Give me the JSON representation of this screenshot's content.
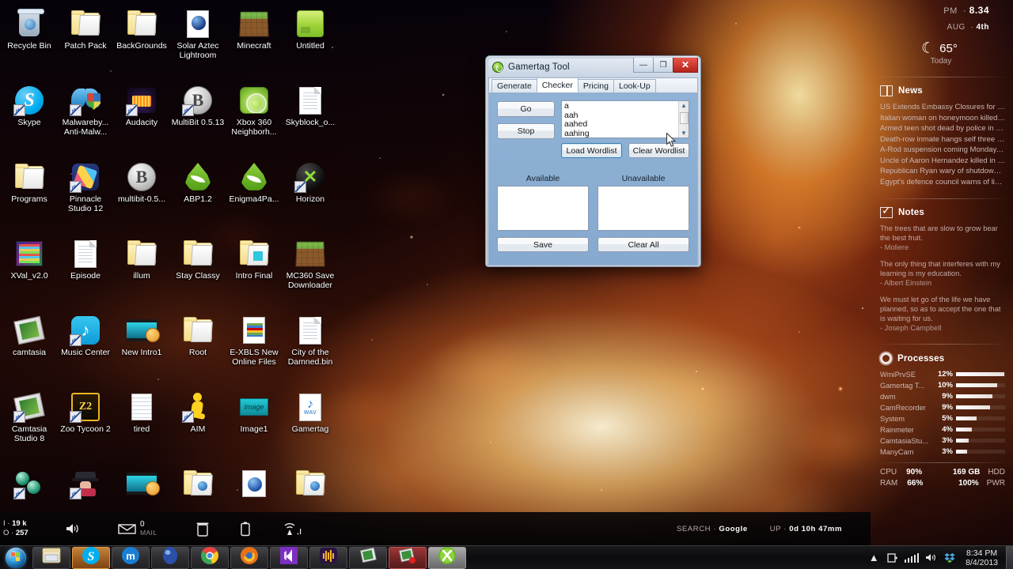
{
  "desktop": {
    "icons": [
      {
        "label": "Recycle Bin",
        "icon": "recycle-bin-icon",
        "type": "trash",
        "shortcut": false
      },
      {
        "label": "Patch Pack",
        "icon": "folder-icon",
        "type": "folder",
        "shortcut": false
      },
      {
        "label": "BackGrounds",
        "icon": "folder-icon",
        "type": "folder",
        "shortcut": false
      },
      {
        "label": "Solar Aztec Lightroom",
        "icon": "document-icon",
        "type": "solar",
        "shortcut": false
      },
      {
        "label": "Minecraft",
        "icon": "minecraft-icon",
        "type": "minecraft",
        "shortcut": false
      },
      {
        "label": "Untitled",
        "icon": "image-icon",
        "type": "untitled",
        "shortcut": false
      },
      {
        "label": "Skype",
        "icon": "skype-icon",
        "type": "skype",
        "shortcut": true
      },
      {
        "label": "Malwareby... Anti-Malw...",
        "icon": "malwarebytes-icon",
        "type": "malware",
        "shortcut": true
      },
      {
        "label": "Audacity",
        "icon": "audacity-icon",
        "type": "audacity",
        "shortcut": true
      },
      {
        "label": "MultiBit 0.5.13",
        "icon": "bitcoin-icon",
        "type": "bitcoin",
        "shortcut": true
      },
      {
        "label": "Xbox 360 Neighborh...",
        "icon": "xbox-neighborhood-icon",
        "type": "xboxgreen",
        "shortcut": false
      },
      {
        "label": "Skyblock_o...",
        "icon": "document-icon",
        "type": "doc",
        "shortcut": false
      },
      {
        "label": "Programs",
        "icon": "folder-icon",
        "type": "folder",
        "shortcut": false
      },
      {
        "label": "Pinnacle Studio 12",
        "icon": "pinnacle-icon",
        "type": "pinnacle",
        "shortcut": true
      },
      {
        "label": "multibit-0.5...",
        "icon": "bitcoin-icon",
        "type": "bitcoin",
        "shortcut": false
      },
      {
        "label": "ABP1.2",
        "icon": "enigma-drop-icon",
        "type": "drop",
        "shortcut": false
      },
      {
        "label": "Enigma4Pa...",
        "icon": "enigma-drop-icon",
        "type": "drop",
        "shortcut": false
      },
      {
        "label": "Horizon",
        "icon": "xbox-icon",
        "type": "xbox",
        "shortcut": true
      },
      {
        "label": "XVal_v2.0",
        "icon": "winrar-archive-icon",
        "type": "winrar",
        "shortcut": false
      },
      {
        "label": "Episode",
        "icon": "document-icon",
        "type": "doc",
        "shortcut": false
      },
      {
        "label": "illum",
        "icon": "folder-icon",
        "type": "folder",
        "shortcut": false
      },
      {
        "label": "Stay Classy",
        "icon": "folder-icon",
        "type": "folder",
        "shortcut": false
      },
      {
        "label": "Intro Final",
        "icon": "folder-icon",
        "type": "folder-video",
        "shortcut": false
      },
      {
        "label": "MC360 Save Downloader",
        "icon": "minecraft-icon",
        "type": "minecraft",
        "shortcut": false
      },
      {
        "label": "camtasia",
        "icon": "camtasia-icon",
        "type": "camtasia",
        "shortcut": false
      },
      {
        "label": "Music Center",
        "icon": "music-icon",
        "type": "music",
        "shortcut": true
      },
      {
        "label": "New Intro1",
        "icon": "video-file-icon",
        "type": "video",
        "shortcut": false
      },
      {
        "label": "Root",
        "icon": "folder-icon",
        "type": "folder-doc",
        "shortcut": false
      },
      {
        "label": "E-XBLS New Online Files",
        "icon": "archive-icon",
        "type": "exbls",
        "shortcut": false
      },
      {
        "label": "City of the Damned.bin",
        "icon": "document-icon",
        "type": "doc",
        "shortcut": false
      },
      {
        "label": "Camtasia Studio 8",
        "icon": "camtasia-icon",
        "type": "camtasia",
        "shortcut": true
      },
      {
        "label": "Zoo Tycoon 2",
        "icon": "zoo-tycoon-icon",
        "type": "zoo",
        "shortcut": true
      },
      {
        "label": "tired",
        "icon": "notepad-icon",
        "type": "notepad",
        "shortcut": false
      },
      {
        "label": "AIM",
        "icon": "aim-icon",
        "type": "aim",
        "shortcut": true
      },
      {
        "label": "Image1",
        "icon": "image-icon",
        "type": "teal",
        "shortcut": false
      },
      {
        "label": "Gamertag",
        "icon": "wav-file-icon",
        "type": "wav",
        "shortcut": false
      },
      {
        "label": "",
        "icon": "atom-icon",
        "type": "atom",
        "shortcut": true
      },
      {
        "label": "",
        "icon": "spy-icon",
        "type": "spy",
        "shortcut": true
      },
      {
        "label": "",
        "icon": "video-file-icon",
        "type": "video",
        "shortcut": false
      },
      {
        "label": "",
        "icon": "folder-icon",
        "type": "folder-globe",
        "shortcut": false
      },
      {
        "label": "",
        "icon": "globe-document-icon",
        "type": "globe",
        "shortcut": false
      },
      {
        "label": "",
        "icon": "folder-icon",
        "type": "folder-globe",
        "shortcut": false
      }
    ]
  },
  "sidebar": {
    "clock": {
      "meridiem": "PM",
      "time": "8.34",
      "month": "AUG",
      "day": "4th"
    },
    "weather": {
      "icon": "moon-icon",
      "temp": "65°",
      "label": "Today"
    },
    "news": {
      "title": "News",
      "icon": "book-icon",
      "items": [
        "US Extends Embassy Closures for a We...",
        "Italian woman on honeymoon killed in...",
        "Armed teen shot dead by police in Ne...",
        "Death-row inmate hangs self three da...",
        "A-Rod suspension coming Monday, but...",
        "Uncle of Aaron Hernandez killed in m...",
        "Republican Ryan wary of shutdown str...",
        "Egypt's defence council warns of limit..."
      ]
    },
    "notes": {
      "title": "Notes",
      "icon": "checklist-icon",
      "items": [
        {
          "text": "The trees that are slow to grow bear the best fruit.",
          "author": "- Moliere"
        },
        {
          "text": "The only thing that interferes with my learning is my education.",
          "author": "- Albert Einstein"
        },
        {
          "text": "We must let go of the life we have planned, so as to accept the one that is waiting for us.",
          "author": "- Joseph Campbell"
        }
      ]
    },
    "processes": {
      "title": "Processes",
      "icon": "gear-icon",
      "items": [
        {
          "name": "WmiPrvSE",
          "pct": "12%",
          "bar": 98
        },
        {
          "name": "Gamertag T...",
          "pct": "10%",
          "bar": 84
        },
        {
          "name": "dwm",
          "pct": "9%",
          "bar": 74
        },
        {
          "name": "CamRecorder",
          "pct": "9%",
          "bar": 70
        },
        {
          "name": "System",
          "pct": "5%",
          "bar": 42
        },
        {
          "name": "Rainmeter",
          "pct": "4%",
          "bar": 33
        },
        {
          "name": "CamtasiaStu...",
          "pct": "3%",
          "bar": 25
        },
        {
          "name": "ManyCam",
          "pct": "3%",
          "bar": 23
        }
      ],
      "system": {
        "cpu_label": "CPU",
        "cpu_value": "90%",
        "ram_label": "RAM",
        "ram_value": "66%",
        "hdd_label": "HDD",
        "hdd_value": "169 GB",
        "pwr_label": "PWR",
        "pwr_value": "100%"
      }
    }
  },
  "dock": {
    "net_in_label": "I",
    "net_in_value": "19 k",
    "net_out_label": "O",
    "net_out_value": "257",
    "volume_icon": "speaker-icon",
    "mail_icon": "envelope-icon",
    "mail_count": "0",
    "mail_label": "MAIL",
    "trash_icon": "trash-icon",
    "battery_icon": "battery-icon",
    "wifi_icon": "wifi-icon",
    "search_label": "SEARCH",
    "search_engine": "Google",
    "uptime_label": "UP",
    "uptime_value": "0d 10h 47mm"
  },
  "taskbar": {
    "start_label": "start-orb",
    "buttons": [
      {
        "name": "explorer",
        "icon": "folder-window-icon",
        "state": "normal"
      },
      {
        "name": "skype",
        "icon": "skype-icon",
        "state": "active"
      },
      {
        "name": "maxthon",
        "icon": "maxthon-icon",
        "state": "normal"
      },
      {
        "name": "blue-ball-app",
        "icon": "blue-sphere-icon",
        "state": "normal"
      },
      {
        "name": "chrome",
        "icon": "chrome-icon",
        "state": "normal"
      },
      {
        "name": "firefox",
        "icon": "firefox-icon",
        "state": "normal"
      },
      {
        "name": "visual-studio",
        "icon": "visual-studio-icon",
        "state": "normal"
      },
      {
        "name": "audacity",
        "icon": "audacity-icon",
        "state": "normal"
      },
      {
        "name": "camtasia",
        "icon": "camtasia-icon",
        "state": "normal"
      },
      {
        "name": "camtasia-rec",
        "icon": "camtasia-record-icon",
        "state": "red"
      },
      {
        "name": "gamertag-tool",
        "icon": "xbox-icon",
        "state": "green"
      }
    ],
    "tray": {
      "chevron_icon": "show-hidden-icons-icon",
      "action_center_icon": "action-center-icon",
      "network_icon": "network-signal-icon",
      "volume_icon": "speaker-icon",
      "dropbox_icon": "dropbox-icon",
      "time": "8:34 PM",
      "date": "8/4/2013"
    }
  },
  "gamertag_window": {
    "title": "Gamertag Tool",
    "app_icon": "xbox-app-icon",
    "window_buttons": {
      "minimize": "—",
      "maximize": "❐",
      "close": "✕"
    },
    "tabs": [
      {
        "label": "Generate",
        "selected": false
      },
      {
        "label": "Checker",
        "selected": true
      },
      {
        "label": "Pricing",
        "selected": false
      },
      {
        "label": "Look-Up",
        "selected": false
      }
    ],
    "checker": {
      "go_button": "Go",
      "stop_button": "Stop",
      "wordlist": [
        "a",
        "aah",
        "aahed",
        "aahing"
      ],
      "load_wordlist_button": "Load Wordlist",
      "clear_wordlist_button": "Clear Wordlist",
      "available_label": "Available",
      "unavailable_label": "Unavailable",
      "available_items": [],
      "unavailable_items": [],
      "save_button": "Save",
      "clear_all_button": "Clear All"
    }
  }
}
